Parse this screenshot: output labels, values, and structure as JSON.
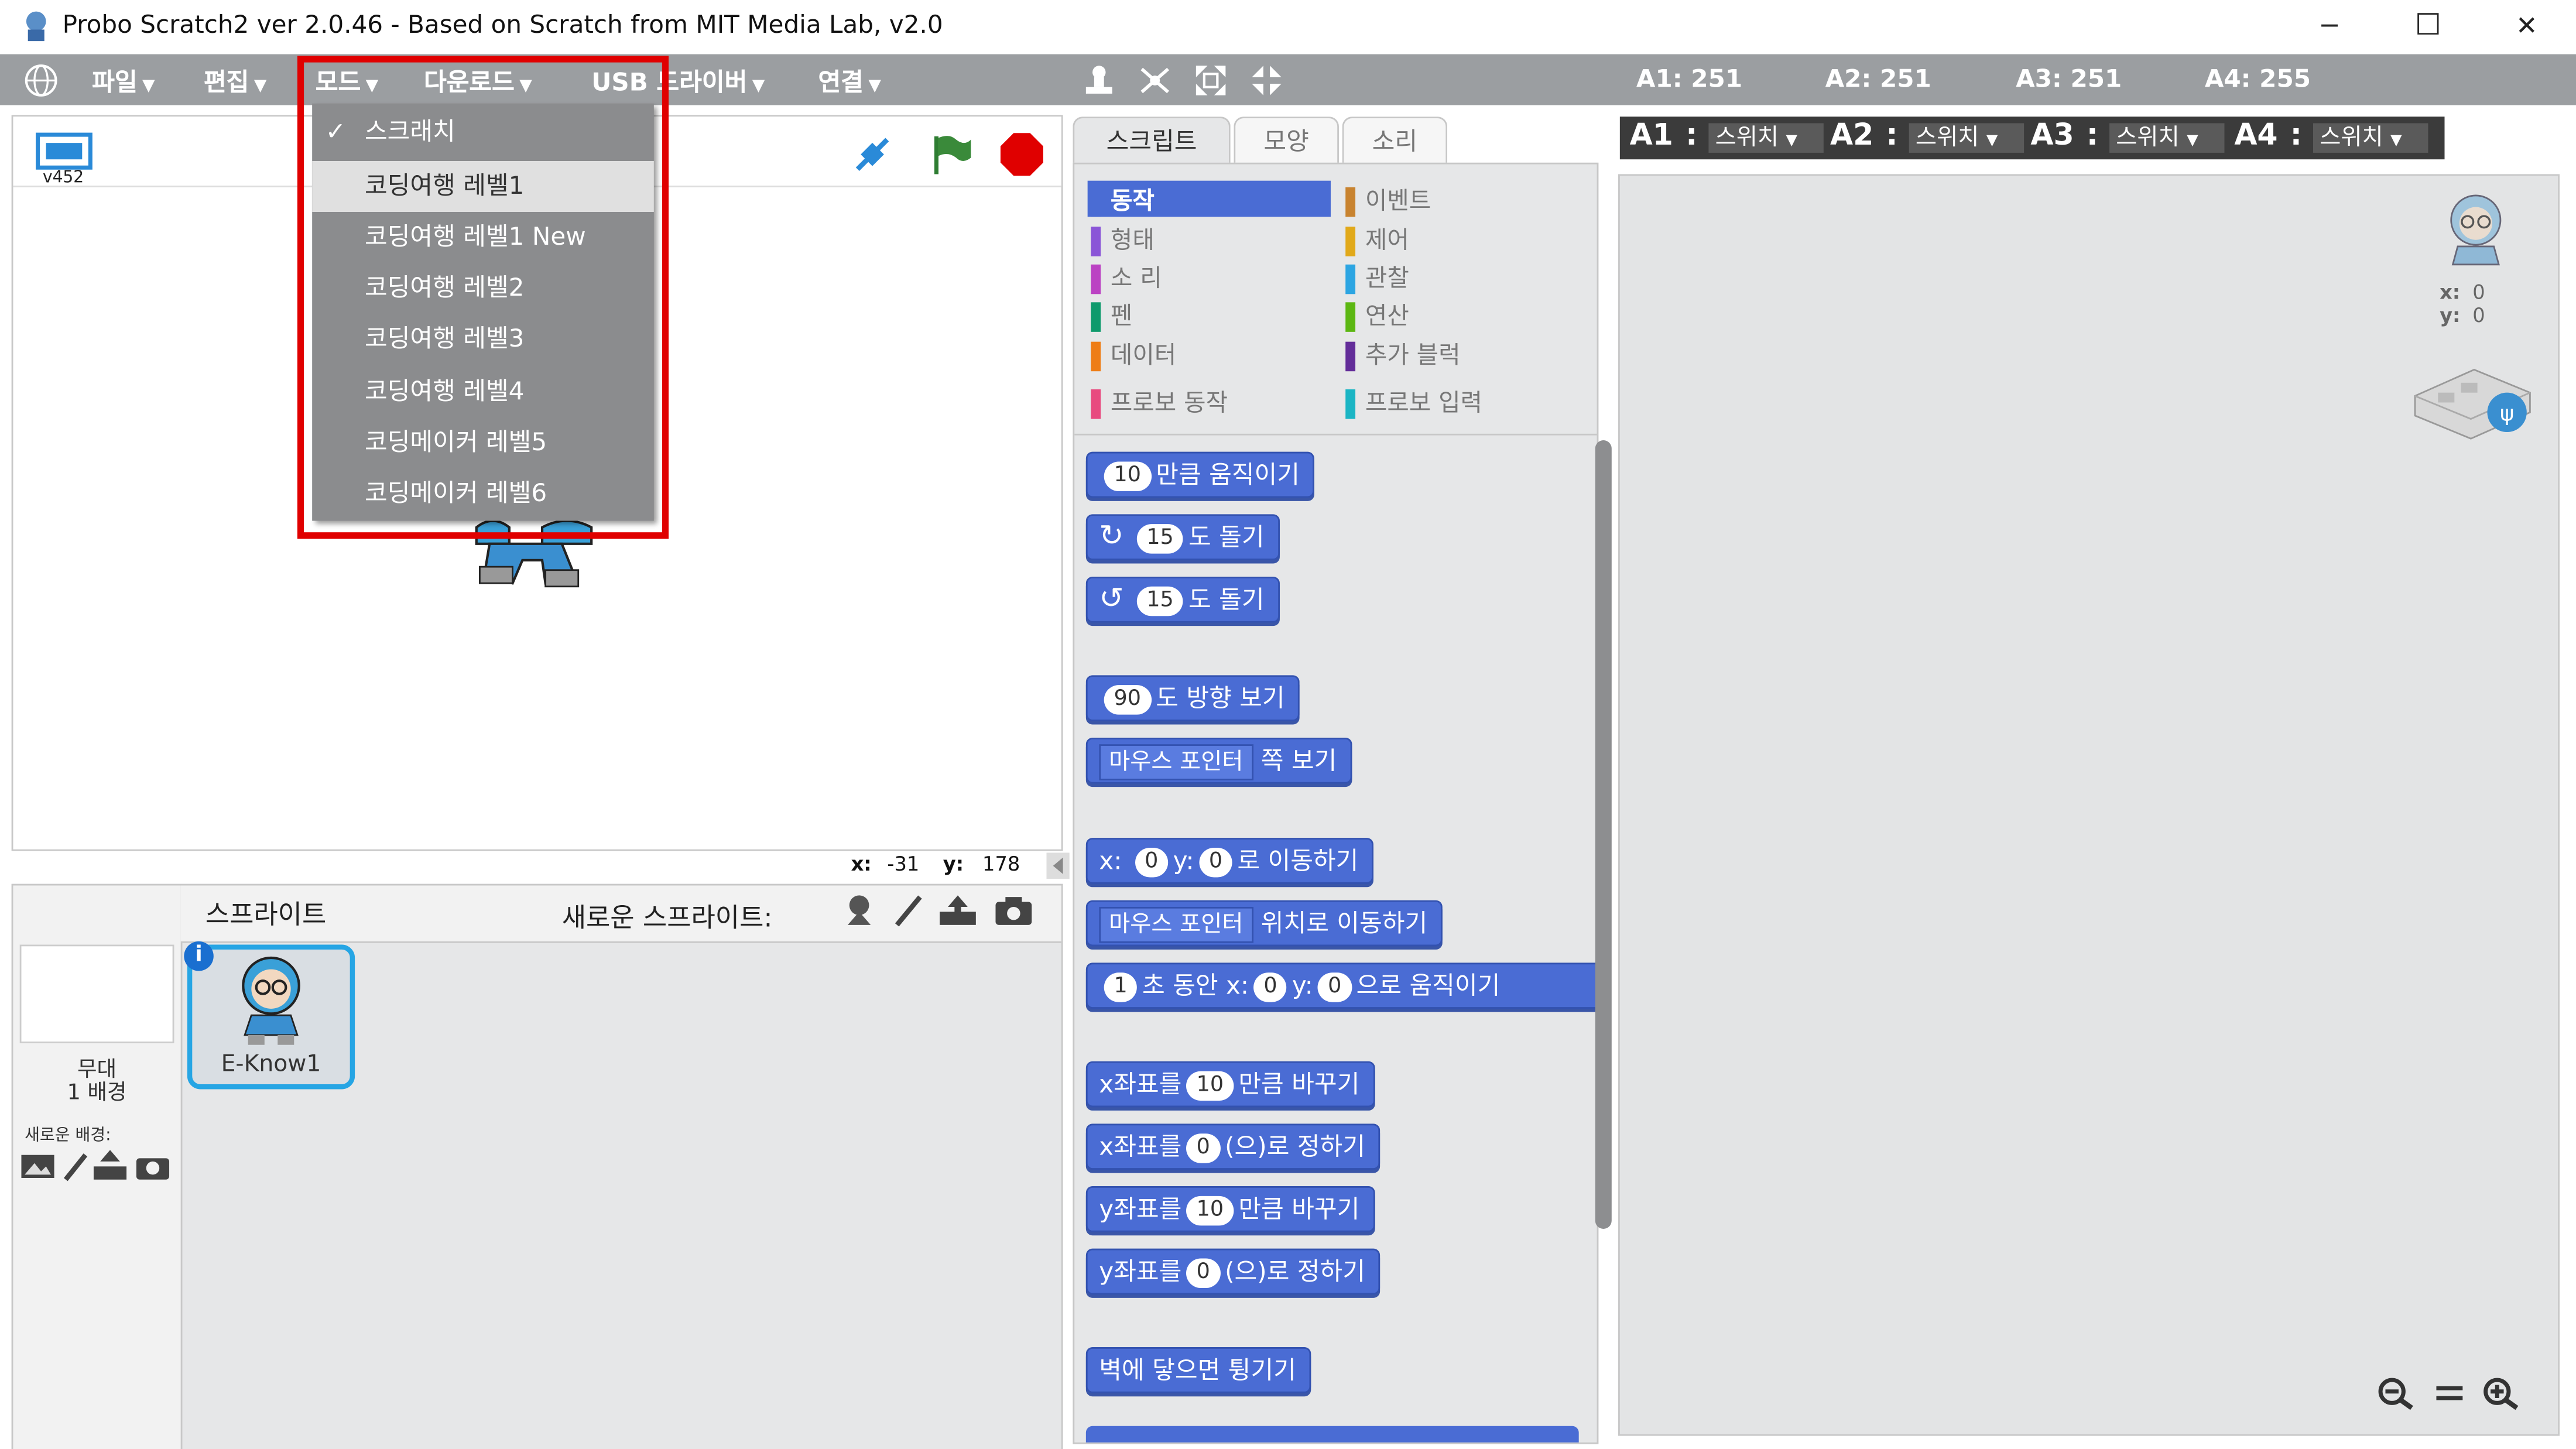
{
  "window": {
    "title": "Probo Scratch2 ver 2.0.46 - Based on Scratch from MIT Media Lab, v2.0",
    "minimize": "─",
    "maximize": "☐",
    "close": "✕"
  },
  "menubar": {
    "globe": "🌐",
    "items": [
      "파일",
      "편집",
      "모드",
      "다운로드",
      "USB 드라이버",
      "연결"
    ],
    "arrow": "▼",
    "analog": [
      "A1: 251",
      "A2: 251",
      "A3: 251",
      "A4: 255"
    ]
  },
  "mode_menu": {
    "check": "✓",
    "items": [
      "스크래치",
      "코딩여행 레벨1",
      "코딩여행 레벨1 New",
      "코딩여행 레벨2",
      "코딩여행 레벨3",
      "코딩여행 레벨4",
      "코딩메이커 레벨5",
      "코딩메이커 레벨6"
    ],
    "checked_index": 0,
    "highlighted_index": 1
  },
  "stage": {
    "version": "v452",
    "mouse_x_label": "x:",
    "mouse_x": "-31",
    "mouse_y_label": "y:",
    "mouse_y": "178"
  },
  "sprites": {
    "header": "스프라이트",
    "new_sprite_label": "새로운 스프라이트:",
    "stage_label": "무대",
    "backdrop_count": "1 배경",
    "new_backdrop_label": "새로운 배경:",
    "sprite_name": "E-Know1",
    "info": "i"
  },
  "tabs": [
    "스크립트",
    "모양",
    "소리"
  ],
  "categories": {
    "left": [
      "동작",
      "형태",
      "소 리",
      "펜",
      "데이터",
      "프로보 동작"
    ],
    "right": [
      "이벤트",
      "제어",
      "관찰",
      "연산",
      "추가 블럭",
      "프로보 입력"
    ]
  },
  "blocks": {
    "move": {
      "value": "10",
      "text": "만큼 움직이기"
    },
    "turn_right": {
      "value": "15",
      "text": "도 돌기"
    },
    "turn_left": {
      "value": "15",
      "text": "도 돌기"
    },
    "point_dir": {
      "value": "90",
      "text": "도 방향 보기"
    },
    "point_towards": {
      "dropdown": "마우스 포인터",
      "text": "쪽 보기"
    },
    "goto_xy": {
      "x_label": "x:",
      "x": "0",
      "y_label": "y:",
      "y": "0",
      "text": "로 이동하기"
    },
    "goto": {
      "dropdown": "마우스 포인터",
      "text": "위치로 이동하기"
    },
    "glide": {
      "secs": "1",
      "text1": "초 동안 x:",
      "x": "0",
      "y_label": "y:",
      "y": "0",
      "text2": "으로 움직이기"
    },
    "change_x": {
      "prefix": "x좌표를",
      "value": "10",
      "text": "만큼 바꾸기"
    },
    "set_x": {
      "prefix": "x좌표를",
      "value": "0",
      "text": "(으)로 정하기"
    },
    "change_y": {
      "prefix": "y좌표를",
      "value": "10",
      "text": "만큼 바꾸기"
    },
    "set_y": {
      "prefix": "y좌표를",
      "value": "0",
      "text": "(으)로 정하기"
    },
    "bounce": {
      "text": "벽에 닿으면 튕기기"
    }
  },
  "analog_bar": {
    "labels": [
      "A1",
      "A2",
      "A3",
      "A4"
    ],
    "colon": ":",
    "values": [
      "스위치",
      "스위치",
      "스위치",
      "스위치"
    ]
  },
  "script_area": {
    "x_label": "x:",
    "x": "0",
    "y_label": "y:",
    "y": "0"
  },
  "colors": {
    "menubar": "#9b9ea1",
    "motion": "#4a6cd4",
    "highlight": "#e00000"
  }
}
